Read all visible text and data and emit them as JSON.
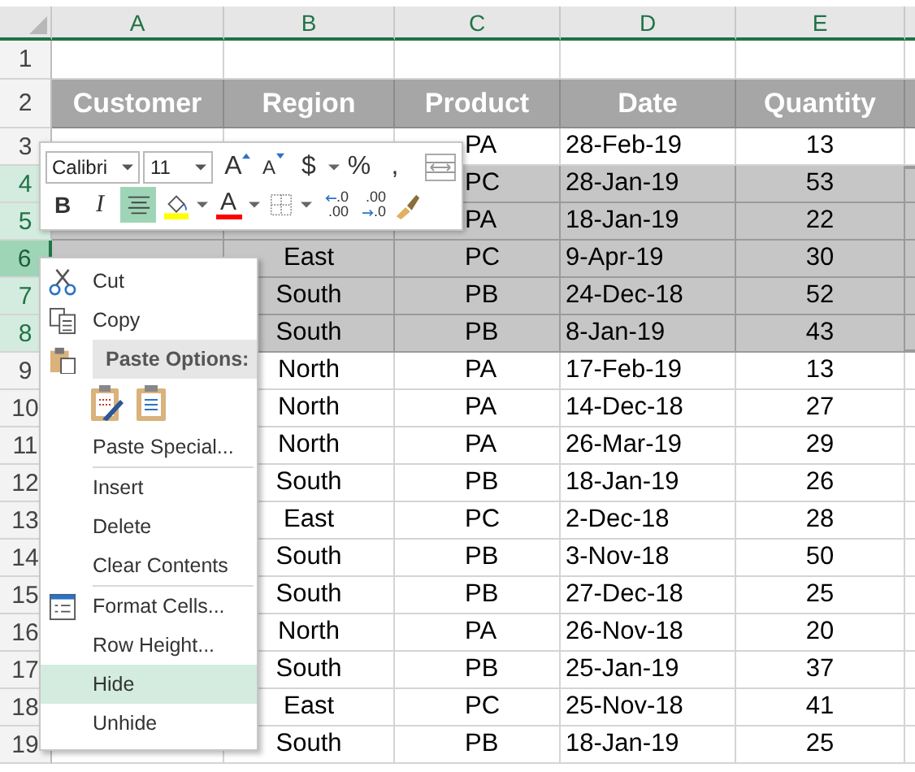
{
  "columns": [
    "A",
    "B",
    "C",
    "D",
    "E"
  ],
  "header": {
    "row": "2",
    "cells": [
      "Customer",
      "Region",
      "Product",
      "Date",
      "Quantity"
    ]
  },
  "rows": [
    {
      "number": "3",
      "product": "PA",
      "date": "28-Feb-19",
      "quantity": "13",
      "selected": false,
      "active": false
    },
    {
      "number": "4",
      "product": "PC",
      "date": "28-Jan-19",
      "quantity": "53",
      "selected": true,
      "active": false
    },
    {
      "number": "5",
      "product": "PA",
      "date": "18-Jan-19",
      "quantity": "22",
      "selected": true,
      "active": false
    },
    {
      "number": "6",
      "region": "East",
      "product": "PC",
      "date": "9-Apr-19",
      "quantity": "30",
      "selected": true,
      "active": true
    },
    {
      "number": "7",
      "region": "South",
      "product": "PB",
      "date": "24-Dec-18",
      "quantity": "52",
      "selected": true,
      "active": false
    },
    {
      "number": "8",
      "region": "South",
      "product": "PB",
      "date": "8-Jan-19",
      "quantity": "43",
      "selected": true,
      "active": false
    },
    {
      "number": "9",
      "region": "North",
      "product": "PA",
      "date": "17-Feb-19",
      "quantity": "13",
      "selected": false,
      "active": false
    },
    {
      "number": "10",
      "region": "North",
      "product": "PA",
      "date": "14-Dec-18",
      "quantity": "27",
      "selected": false,
      "active": false
    },
    {
      "number": "11",
      "region": "North",
      "product": "PA",
      "date": "26-Mar-19",
      "quantity": "29",
      "selected": false,
      "active": false
    },
    {
      "number": "12",
      "region": "South",
      "product": "PB",
      "date": "18-Jan-19",
      "quantity": "26",
      "selected": false,
      "active": false
    },
    {
      "number": "13",
      "region": "East",
      "product": "PC",
      "date": "2-Dec-18",
      "quantity": "28",
      "selected": false,
      "active": false
    },
    {
      "number": "14",
      "region": "South",
      "product": "PB",
      "date": "3-Nov-18",
      "quantity": "50",
      "selected": false,
      "active": false
    },
    {
      "number": "15",
      "region": "South",
      "product": "PB",
      "date": "27-Dec-18",
      "quantity": "25",
      "selected": false,
      "active": false
    },
    {
      "number": "16",
      "region": "North",
      "product": "PA",
      "date": "26-Nov-18",
      "quantity": "20",
      "selected": false,
      "active": false
    },
    {
      "number": "17",
      "region": "South",
      "product": "PB",
      "date": "25-Jan-19",
      "quantity": "37",
      "selected": false,
      "active": false
    },
    {
      "number": "18",
      "region": "East",
      "product": "PC",
      "date": "25-Nov-18",
      "quantity": "41",
      "selected": false,
      "active": false
    },
    {
      "number": "19",
      "region": "South",
      "product": "PB",
      "date": "18-Jan-19",
      "quantity": "25",
      "selected": false,
      "active": false
    }
  ],
  "row_1": {
    "number": "1"
  },
  "mini_toolbar": {
    "font": "Calibri",
    "size": "11",
    "row_1": [
      {
        "kind": "grow",
        "label": "A"
      },
      {
        "kind": "shrink",
        "label": "A"
      },
      {
        "kind": "text",
        "label": "$",
        "dropdown": true
      },
      {
        "kind": "text",
        "label": "%"
      },
      {
        "kind": "text",
        "label": ","
      },
      {
        "kind": "merge"
      }
    ],
    "row_2": [
      {
        "kind": "bold",
        "label": "B",
        "selected": false
      },
      {
        "kind": "italic",
        "label": "I",
        "selected": false
      },
      {
        "kind": "align",
        "selected": true
      },
      {
        "kind": "fill",
        "color": "#ffff00",
        "dropdown": true,
        "selected": false
      },
      {
        "kind": "fontcolor",
        "label": "A",
        "color": "#ff0000",
        "dropdown": true,
        "selected": false
      },
      {
        "kind": "borders",
        "dropdown": true,
        "selected": false
      },
      {
        "kind": "increase-decimal",
        "top": ".0",
        "bottom": ".00",
        "selected": false
      },
      {
        "kind": "decrease-decimal",
        "top": ".00",
        "bottom": ".0",
        "selected": false
      },
      {
        "kind": "painter",
        "selected": false
      }
    ]
  },
  "context_menu": [
    {
      "kind": "cut",
      "label": "Cut",
      "selected": false
    },
    {
      "kind": "copy",
      "label": "Copy",
      "selected": false
    },
    {
      "kind": "paste-header",
      "label": "Paste Options:",
      "selected": false
    },
    {
      "kind": "paste-icons",
      "selected": false
    },
    {
      "kind": "plain",
      "label": "Paste Special...",
      "selected": false
    },
    {
      "kind": "separator"
    },
    {
      "kind": "plain",
      "label": "Insert",
      "selected": false
    },
    {
      "kind": "plain",
      "label": "Delete",
      "selected": false
    },
    {
      "kind": "plain",
      "label": "Clear Contents",
      "selected": false
    },
    {
      "kind": "separator"
    },
    {
      "kind": "format",
      "label": "Format Cells...",
      "selected": false
    },
    {
      "kind": "plain",
      "label": "Row Height...",
      "selected": false
    },
    {
      "kind": "plain",
      "label": "Hide",
      "selected": true
    },
    {
      "kind": "plain",
      "label": "Unhide",
      "selected": false
    }
  ]
}
